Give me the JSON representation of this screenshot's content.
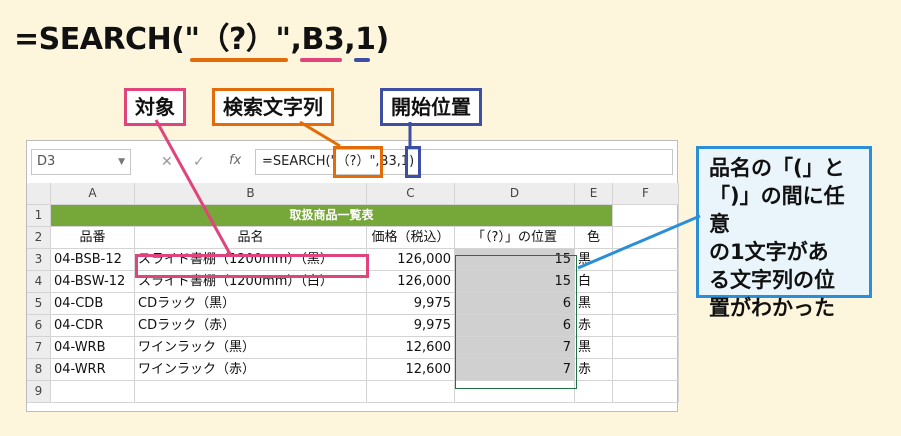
{
  "formula": {
    "text": "=SEARCH(\"（?）\",B3,1)",
    "colors": {
      "target": "#e0447c",
      "search": "#e36c0a",
      "start": "#3c4fa3"
    }
  },
  "callouts": {
    "target": "対象",
    "search_string": "検索文字列",
    "start_position": "開始位置",
    "note_lines": [
      "品名の「(」と",
      "「)」の間に任意",
      "の1文字があ",
      "る文字列の位",
      "置がわかった"
    ]
  },
  "excel": {
    "name_box": "D3",
    "formula_bar": "=SEARCH(\"（?）\",B3,1)",
    "fx_label": "fx",
    "cancel_glyph": "✕",
    "enter_glyph": "✓",
    "columns": [
      "A",
      "B",
      "C",
      "D",
      "E",
      "F"
    ],
    "row_numbers": [
      "1",
      "2",
      "3",
      "4",
      "5",
      "6",
      "7",
      "8",
      "9"
    ],
    "table_title": "取扱商品一覧表",
    "headers": [
      "品番",
      "品名",
      "価格（税込）",
      "「（?）」の位置",
      "色"
    ],
    "rows": [
      [
        "04-BSB-12",
        "スライド書棚（1200mm）（黒）",
        "126,000",
        "15",
        "黒"
      ],
      [
        "04-BSW-12",
        "スライド書棚（1200mm）（白）",
        "126,000",
        "15",
        "白"
      ],
      [
        "04-CDB",
        "CDラック（黒）",
        "9,975",
        "6",
        "黒"
      ],
      [
        "04-CDR",
        "CDラック（赤）",
        "9,975",
        "6",
        "赤"
      ],
      [
        "04-WRB",
        "ワインラック（黒）",
        "12,600",
        "7",
        "黒"
      ],
      [
        "04-WRR",
        "ワインラック（赤）",
        "12,600",
        "7",
        "赤"
      ]
    ]
  }
}
